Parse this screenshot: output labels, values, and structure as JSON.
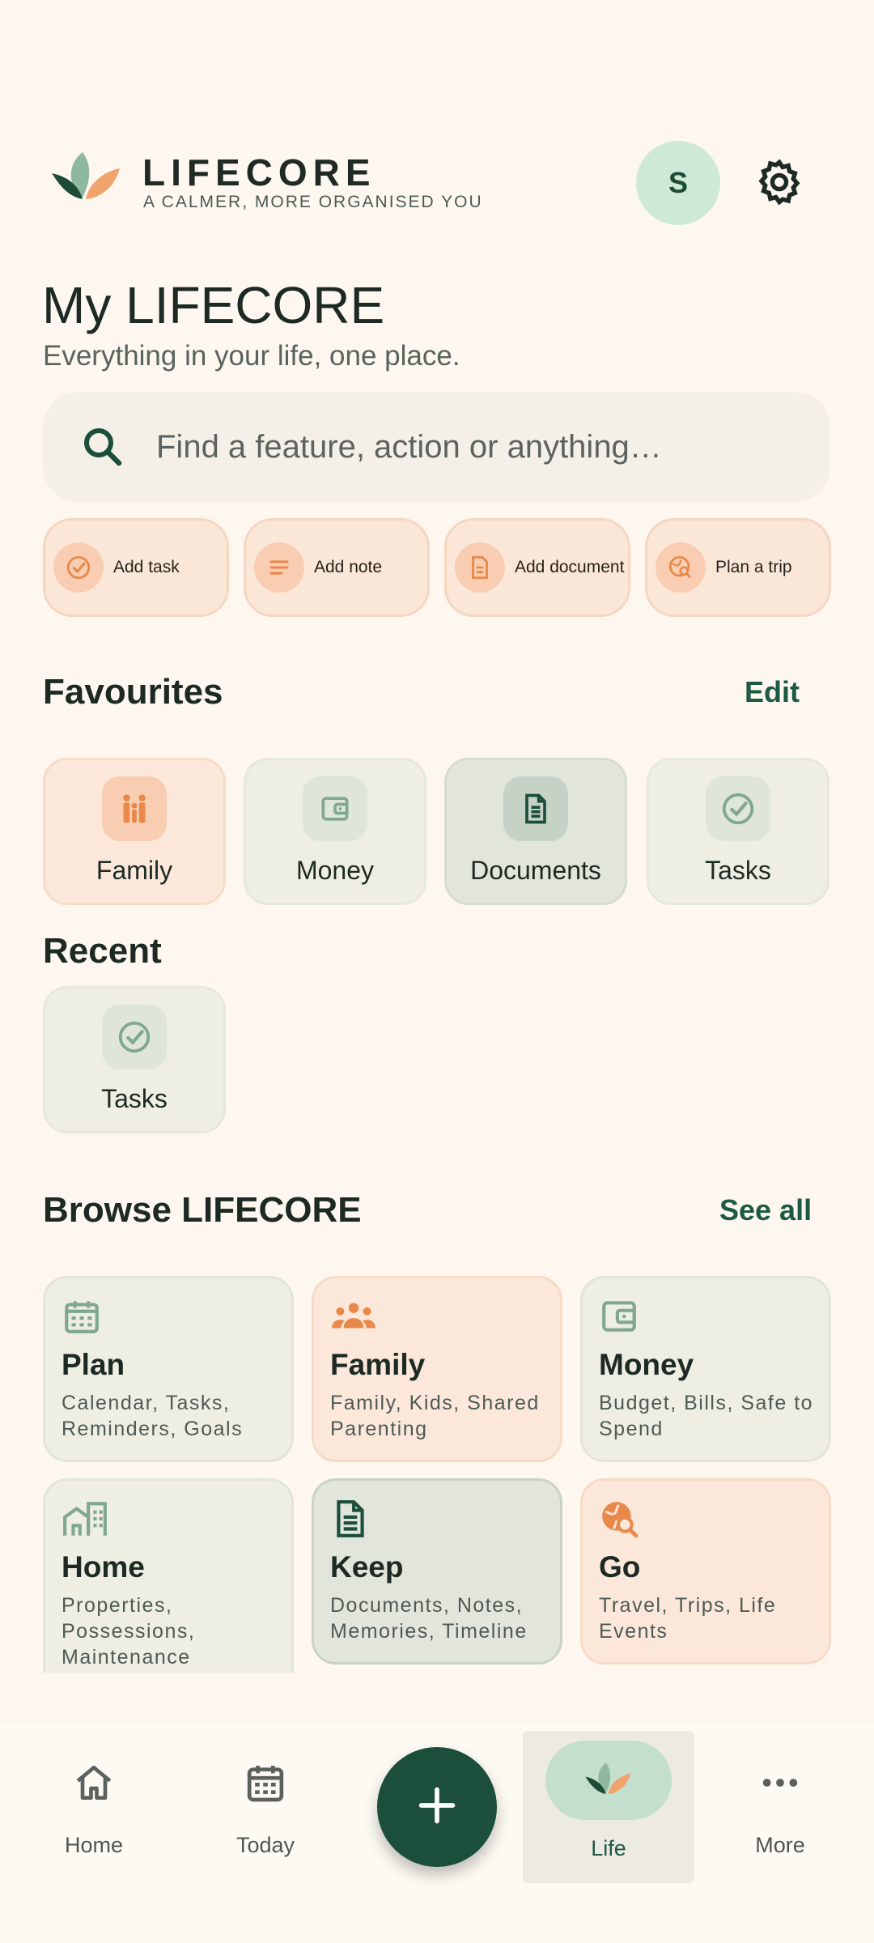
{
  "app": {
    "brand": "LIFECORE",
    "tagline": "A CALMER, MORE ORGANISED YOU",
    "avatar_initial": "S"
  },
  "header": {
    "title": "My LIFECORE",
    "subtitle": "Everything in your life, one place."
  },
  "search": {
    "placeholder": "Find a feature, action or anything…"
  },
  "quick_actions": [
    {
      "label": "Add task",
      "icon": "check-circle-icon"
    },
    {
      "label": "Add note",
      "icon": "note-lines-icon"
    },
    {
      "label": "Add document",
      "icon": "document-icon"
    },
    {
      "label": "Plan a trip",
      "icon": "globe-search-icon"
    }
  ],
  "favourites": {
    "title": "Favourites",
    "edit_label": "Edit",
    "items": [
      {
        "label": "Family",
        "icon": "family-icon"
      },
      {
        "label": "Money",
        "icon": "wallet-icon"
      },
      {
        "label": "Documents",
        "icon": "document-icon"
      },
      {
        "label": "Tasks",
        "icon": "check-circle-icon"
      }
    ]
  },
  "recent": {
    "title": "Recent",
    "items": [
      {
        "label": "Tasks",
        "icon": "check-circle-icon"
      }
    ]
  },
  "browse": {
    "title": "Browse LIFECORE",
    "see_all_label": "See all",
    "cards": [
      {
        "title": "Plan",
        "desc": "Calendar, Tasks, Reminders, Goals",
        "icon": "calendar-icon"
      },
      {
        "title": "Family",
        "desc": "Family, Kids, Shared Parenting",
        "icon": "people-icon"
      },
      {
        "title": "Money",
        "desc": "Budget, Bills, Safe to Spend",
        "icon": "wallet-icon"
      },
      {
        "title": "Home",
        "desc": "Properties, Possessions, Maintenance",
        "icon": "buildings-icon"
      },
      {
        "title": "Keep",
        "desc": "Documents, Notes, Memories, Timeline",
        "icon": "document-icon"
      },
      {
        "title": "Go",
        "desc": "Travel, Trips, Life Events",
        "icon": "globe-search-icon"
      }
    ]
  },
  "bottom_nav": {
    "items": [
      {
        "label": "Home",
        "icon": "house-icon"
      },
      {
        "label": "Today",
        "icon": "calendar-icon"
      },
      {
        "label": "Life",
        "icon": "leaf-logo-icon",
        "active": true
      },
      {
        "label": "More",
        "icon": "more-dots-icon"
      }
    ],
    "fab_icon": "plus-icon"
  },
  "colors": {
    "background": "#fdf7f0",
    "primary_green": "#1b4e3b",
    "accent_orange": "#ef9457",
    "muted_green": "#7fa88e"
  }
}
